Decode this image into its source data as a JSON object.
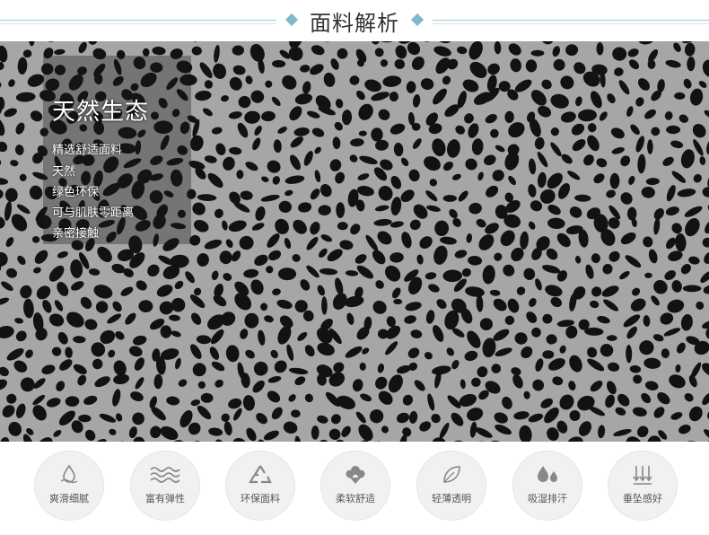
{
  "header": {
    "title": "面料解析"
  },
  "overlay": {
    "title": "天然生态",
    "lines": [
      "精选舒适面料",
      "天然",
      "绿色环保",
      "可与肌肤零距离",
      "亲密接触"
    ]
  },
  "features": [
    {
      "label": "爽滑细腻",
      "icon": "water-drop-cloud-icon"
    },
    {
      "label": "富有弹性",
      "icon": "wave-lines-icon"
    },
    {
      "label": "环保面料",
      "icon": "recycle-icon"
    },
    {
      "label": "柔软舒适",
      "icon": "cotton-flower-icon"
    },
    {
      "label": "轻薄透明",
      "icon": "leaf-icon"
    },
    {
      "label": "吸湿排汗",
      "icon": "drops-icon"
    },
    {
      "label": "垂坠感好",
      "icon": "down-arrows-icon"
    }
  ],
  "colors": {
    "accent": "#7fb9cd",
    "text": "#333333",
    "feature_bg": "#f1f1f1"
  }
}
